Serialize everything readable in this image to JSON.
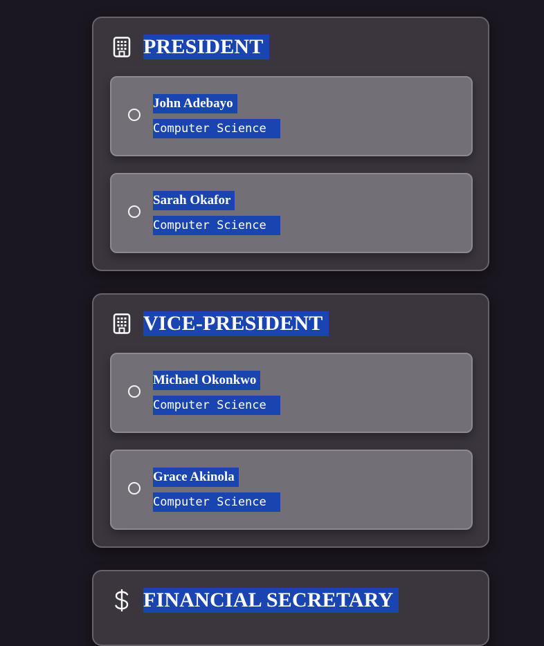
{
  "sections": [
    {
      "title": "PRESIDENT",
      "icon": "building-icon",
      "candidates": [
        {
          "name": "John Adebayo",
          "department": "Computer Science"
        },
        {
          "name": "Sarah Okafor",
          "department": "Computer Science"
        }
      ]
    },
    {
      "title": "VICE-PRESIDENT",
      "icon": "building-icon",
      "candidates": [
        {
          "name": "Michael Okonkwo",
          "department": "Computer Science"
        },
        {
          "name": "Grace Akinola",
          "department": "Computer Science"
        }
      ]
    },
    {
      "title": "FINANCIAL SECRETARY",
      "icon": "dollar-icon",
      "candidates": []
    }
  ],
  "colors": {
    "page_background": "#1b1720",
    "section_background": "#3b363e",
    "candidate_background": "#736f76",
    "text_highlight": "#1a45b0"
  }
}
